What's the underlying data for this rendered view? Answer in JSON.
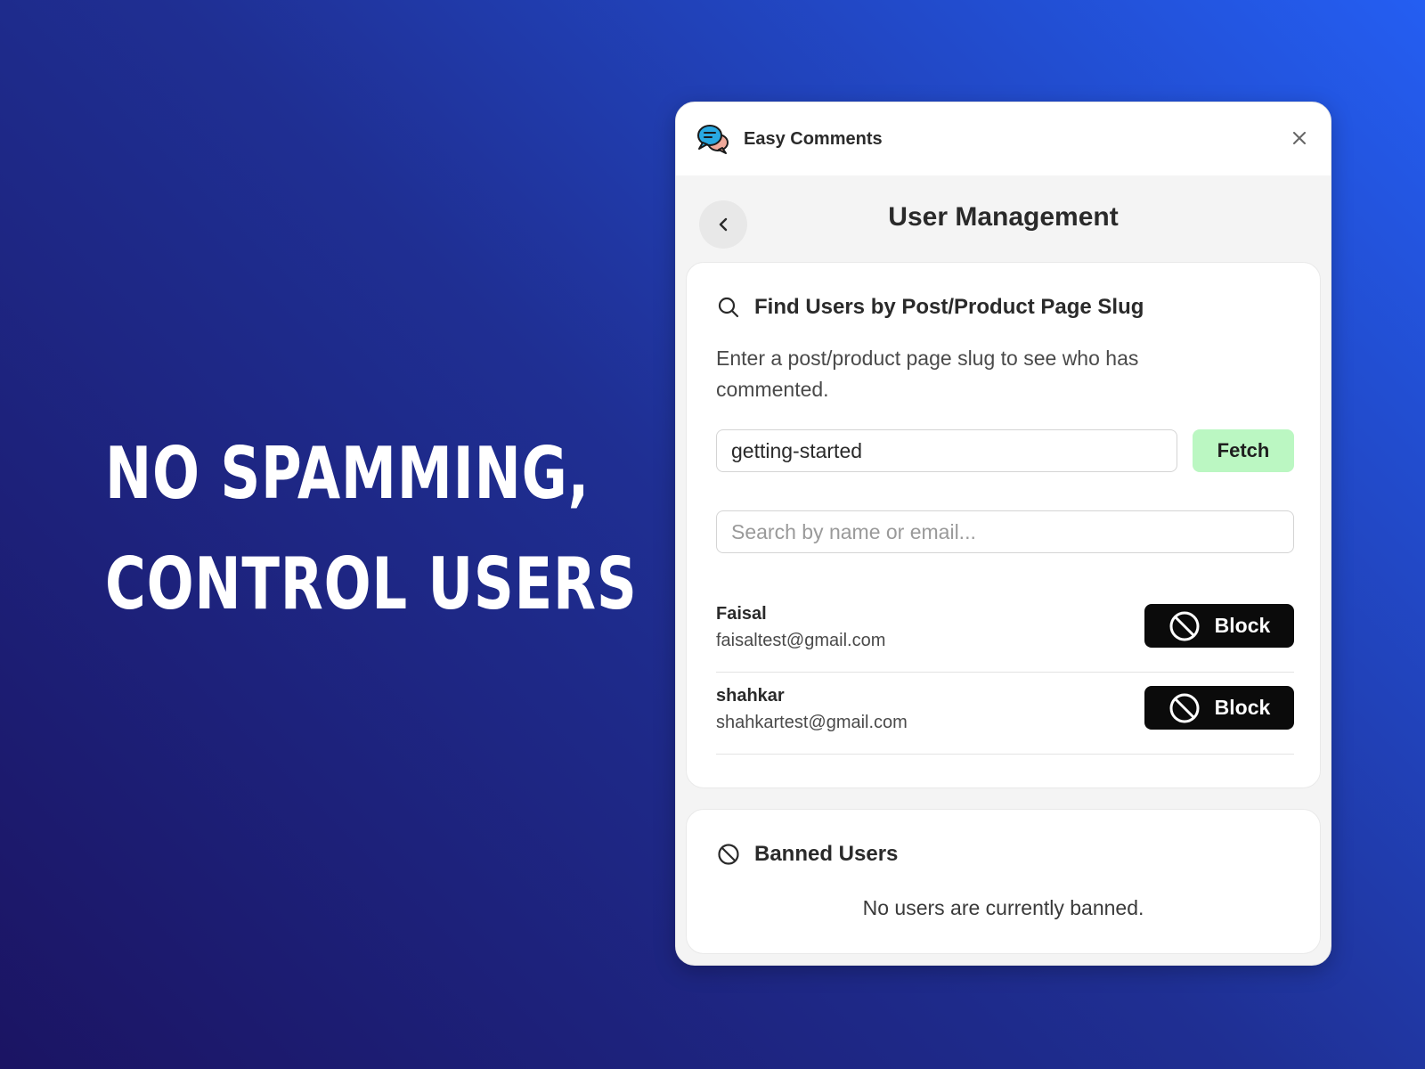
{
  "headline": {
    "line1": "NO SPAMMING,",
    "line2": "CONTROL USERS"
  },
  "window": {
    "app_title": "Easy Comments",
    "app_icon": "chat-bubbles-icon",
    "close_icon": "close-icon"
  },
  "header": {
    "title": "User Management",
    "back_icon": "chevron-left-icon"
  },
  "find_users": {
    "title": "Find Users by Post/Product Page Slug",
    "icon": "search-icon",
    "description": "Enter a post/product page slug to see who has commented.",
    "slug_value": "getting-started",
    "fetch_label": "Fetch",
    "search_placeholder": "Search by name or email...",
    "users": [
      {
        "name": "Faisal",
        "email": "faisaltest@gmail.com",
        "action_label": "Block"
      },
      {
        "name": "shahkar",
        "email": "shahkartest@gmail.com",
        "action_label": "Block"
      }
    ]
  },
  "banned_users": {
    "title": "Banned Users",
    "icon": "ban-icon",
    "empty_message": "No users are currently banned."
  },
  "colors": {
    "fetch_button": "#bbf7c2",
    "block_button": "#0b0b0b",
    "background_start": "#1b1463",
    "background_end": "#245ef2"
  }
}
